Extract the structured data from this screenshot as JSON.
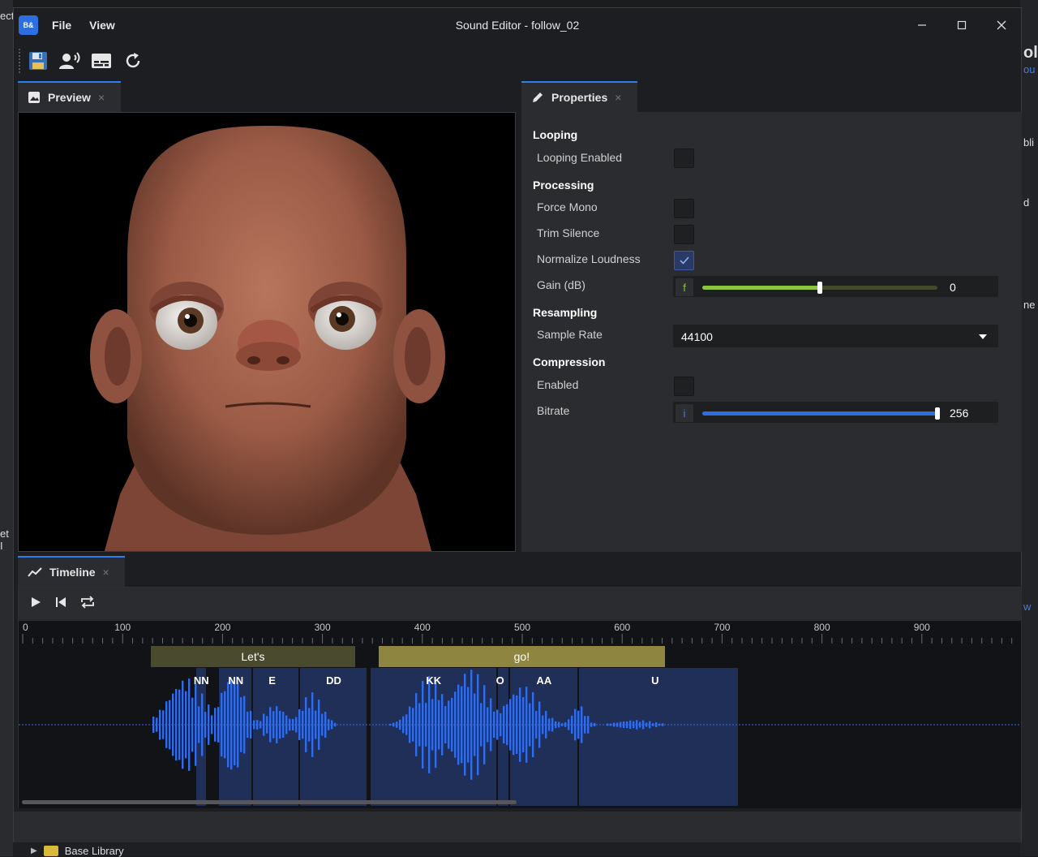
{
  "background": {
    "left_top_text": "ect",
    "left_mid_text": "et I",
    "right_texts": [
      "ol",
      "ou",
      "bli",
      "d",
      "ne",
      "w"
    ],
    "bottom_tree_label": "Base Library"
  },
  "window": {
    "logo_text": "B&",
    "menu": [
      "File",
      "View"
    ],
    "title": "Sound Editor - follow_02"
  },
  "toolbar": {
    "buttons": [
      "save-icon",
      "voice-icon",
      "subtitles-icon",
      "refresh-icon"
    ]
  },
  "preview": {
    "tab_label": "Preview",
    "close": "×"
  },
  "properties": {
    "tab_label": "Properties",
    "close": "×",
    "sections": {
      "looping": "Looping",
      "processing": "Processing",
      "resampling": "Resampling",
      "compression": "Compression"
    },
    "looping_enabled": {
      "label": "Looping Enabled",
      "checked": false
    },
    "force_mono": {
      "label": "Force Mono",
      "checked": false
    },
    "trim_silence": {
      "label": "Trim Silence",
      "checked": false
    },
    "normalize_loudness": {
      "label": "Normalize Loudness",
      "checked": true
    },
    "gain": {
      "label": "Gain (dB)",
      "badge": "f",
      "value": "0",
      "fraction": 0.5
    },
    "sample_rate": {
      "label": "Sample Rate",
      "value": "44100"
    },
    "compression_enabled": {
      "label": "Enabled",
      "checked": false
    },
    "bitrate": {
      "label": "Bitrate",
      "badge": "i",
      "value": "256",
      "fraction": 1.0
    }
  },
  "timeline": {
    "tab_label": "Timeline",
    "close": "×",
    "ruler_ticks": [
      "0",
      "100",
      "200",
      "300",
      "400",
      "500",
      "600",
      "700",
      "800",
      "900"
    ],
    "words": [
      {
        "text": "Let's",
        "start": 128,
        "end": 333
      },
      {
        "text": "go!",
        "start": 356,
        "end": 643
      }
    ],
    "phonemes": [
      {
        "text": "NN",
        "start": 173,
        "end": 184
      },
      {
        "text": "NN",
        "start": 196,
        "end": 230
      },
      {
        "text": "E",
        "start": 230,
        "end": 277
      },
      {
        "text": "DD",
        "start": 277,
        "end": 345
      },
      {
        "text": "KK",
        "start": 347,
        "end": 475
      },
      {
        "text": "O",
        "start": 475,
        "end": 487
      },
      {
        "text": "AA",
        "start": 487,
        "end": 556
      },
      {
        "text": "U",
        "start": 556,
        "end": 717
      }
    ]
  },
  "colors": {
    "accent": "#2d7ff0",
    "gain_fill": "#8cc63f",
    "bitrate_fill": "#2f6ee0",
    "word_lets": "#4a4b2e",
    "word_go": "#8d8540",
    "phoneme_block": "#1f2f57",
    "waveform": "#2e6cf0"
  }
}
